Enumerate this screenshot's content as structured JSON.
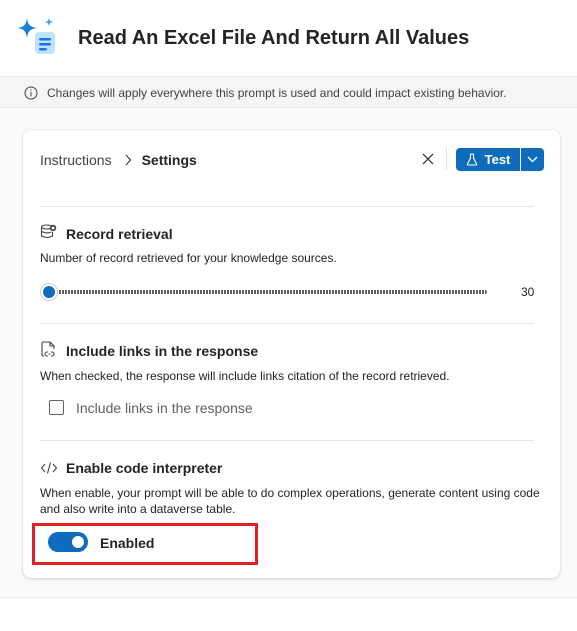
{
  "header": {
    "title": "Read An Excel File And Return All Values",
    "icon": "sparkle-prompt-icon"
  },
  "info_bar": {
    "text": "Changes will apply everywhere this prompt is used and could impact existing behavior."
  },
  "breadcrumb": {
    "items": [
      "Instructions",
      "Settings"
    ]
  },
  "toolbar": {
    "test_label": "Test"
  },
  "sections": {
    "record_retrieval": {
      "title": "Record retrieval",
      "description": "Number of record retrieved for your knowledge sources.",
      "slider_value": "30",
      "slider_fraction": 0.0
    },
    "include_links": {
      "title": "Include links in the response",
      "description": "When checked, the response will include links citation of the record retrieved.",
      "checkbox_label": "Include links in the response",
      "checked": false
    },
    "code_interpreter": {
      "title": "Enable code interpreter",
      "description": "When enable, your prompt will be able to do complex operations, generate content using code and also write into a dataverse table.",
      "toggle_label": "Enabled",
      "toggle_on": true
    }
  },
  "colors": {
    "accent": "#0f6cbd",
    "highlight": "#e01f26"
  }
}
